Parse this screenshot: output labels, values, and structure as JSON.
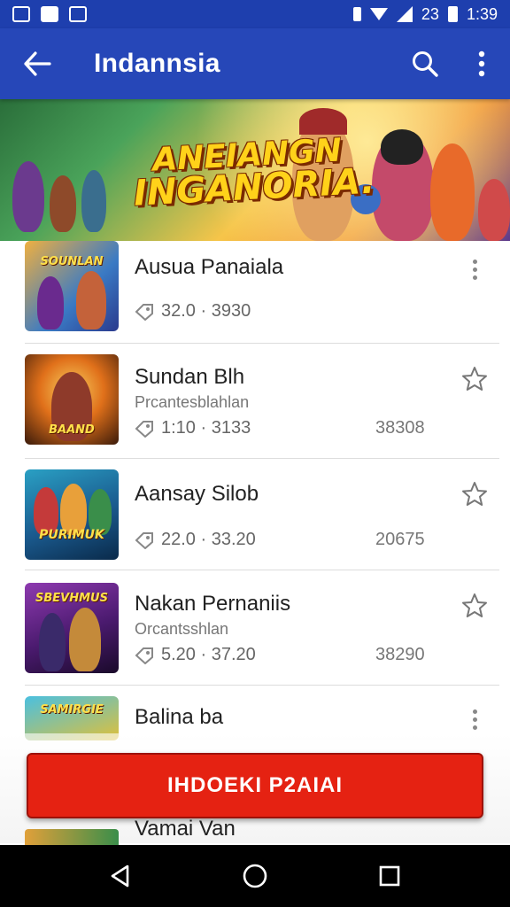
{
  "status_bar": {
    "time": "1:39",
    "signal_text": "23"
  },
  "app_bar": {
    "title": "Indannsia",
    "back_icon": "arrow-left-icon",
    "search_icon": "search-icon",
    "more_icon": "more-vert-icon"
  },
  "banner": {
    "title_line1": "ANEIANGN",
    "title_line2": "INGANORIA."
  },
  "items": [
    {
      "thumb_caption": "SOUNLAN",
      "title": "Ausua Panaiala",
      "subtitle": "",
      "meta": "32.0 · 3930",
      "count": "",
      "action": "more-vert-icon"
    },
    {
      "thumb_caption": "BAAND",
      "title": "Sundan Blh",
      "subtitle": "Prcantesblahlan",
      "meta": "1:10 · 3133",
      "count": "38308",
      "action": "star-icon"
    },
    {
      "thumb_caption": "PURIMUK",
      "title": "Aansay Silob",
      "subtitle": "",
      "meta": "22.0 · 33.20",
      "count": "20675",
      "action": "star-icon"
    },
    {
      "thumb_caption": "SBEVHMUS",
      "title": "Nakan Pernaniis",
      "subtitle": "Orcantsshlan",
      "meta": "5.20 · 37.20",
      "count": "38290",
      "action": "star-icon"
    },
    {
      "thumb_caption": "SAMIRGIE",
      "title": "Balina ba",
      "subtitle": "",
      "meta": "",
      "count": "",
      "action": "more-vert-icon"
    },
    {
      "thumb_caption": "",
      "title": "Vamai Van",
      "subtitle": "",
      "meta": "",
      "count": "",
      "action": ""
    }
  ],
  "cta": {
    "label": "IHDOEKI P2AIAI"
  },
  "colors": {
    "primary": "#2647b8",
    "status": "#1e3fae",
    "cta": "#e52212"
  }
}
